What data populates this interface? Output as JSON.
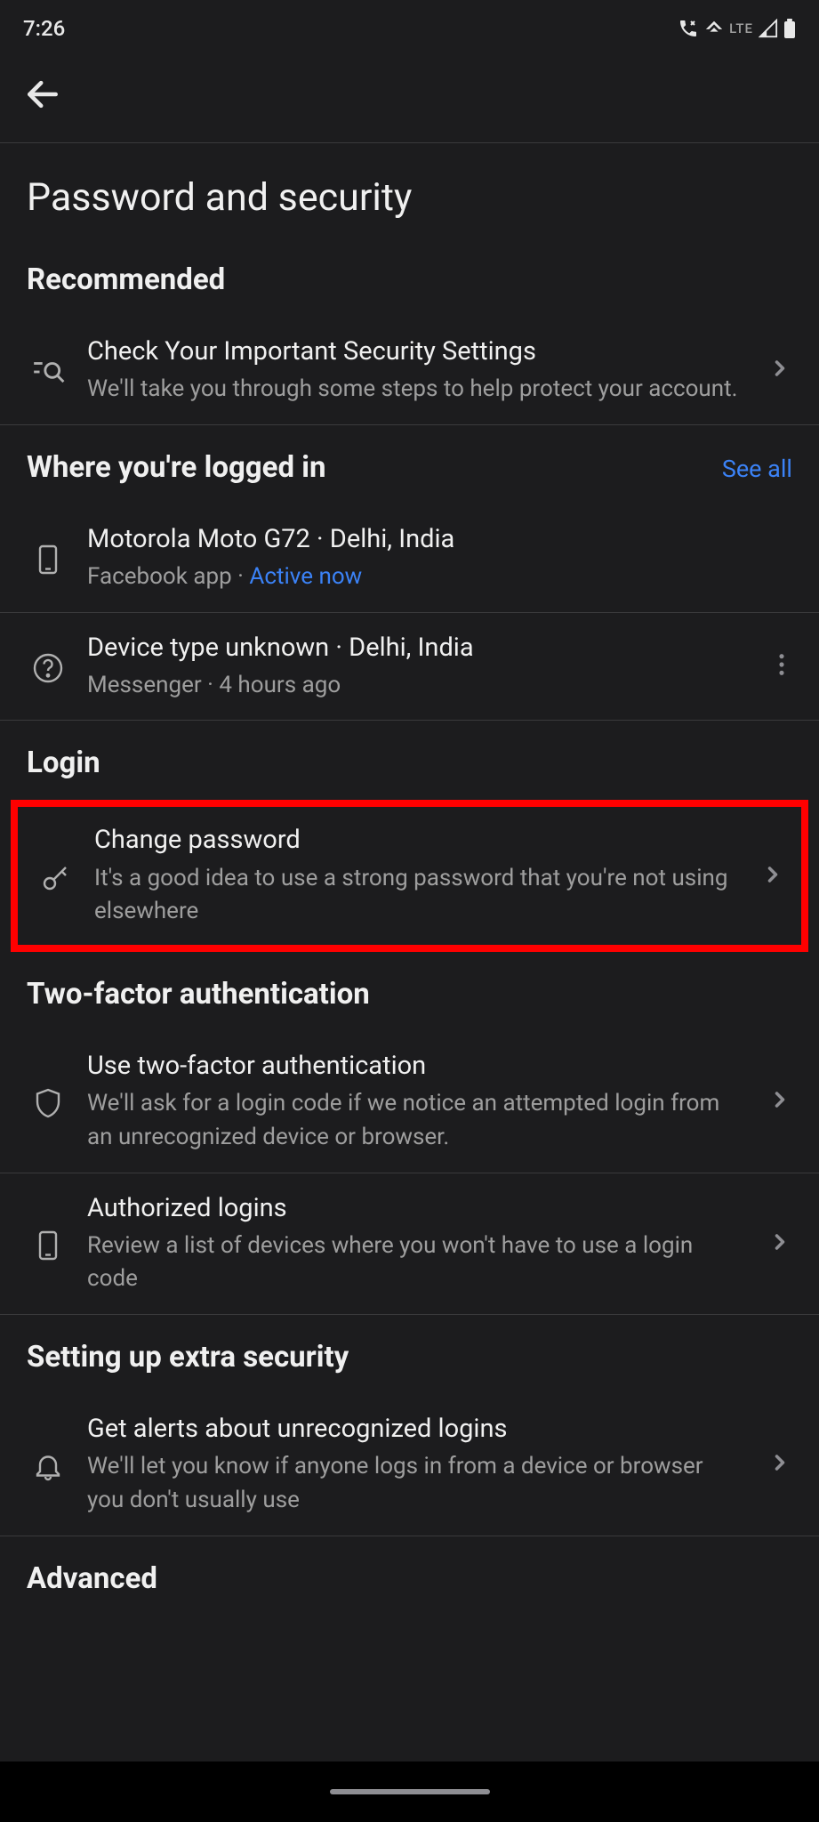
{
  "status": {
    "time": "7:26",
    "lte": "LTE"
  },
  "page": {
    "title": "Password and security"
  },
  "recommended": {
    "heading": "Recommended",
    "item": {
      "title": "Check Your Important Security Settings",
      "subtitle": "We'll take you through some steps to help protect your account."
    }
  },
  "loggedIn": {
    "heading": "Where you're logged in",
    "seeAll": "See all",
    "devices": [
      {
        "title": "Motorola Moto G72 · Delhi, India",
        "app": "Facebook app · ",
        "status": "Active now"
      },
      {
        "title": "Device type unknown · Delhi, India",
        "app": "Messenger · 4 hours ago"
      }
    ]
  },
  "login": {
    "heading": "Login",
    "changePassword": {
      "title": "Change password",
      "subtitle": "It's a good idea to use a strong password that you're not using elsewhere"
    }
  },
  "twoFactor": {
    "heading": "Two-factor authentication",
    "use": {
      "title": "Use two-factor authentication",
      "subtitle": "We'll ask for a login code if we notice an attempted login from an unrecognized device or browser."
    },
    "authorized": {
      "title": "Authorized logins",
      "subtitle": "Review a list of devices where you won't have to use a login code"
    }
  },
  "extraSecurity": {
    "heading": "Setting up extra security",
    "alerts": {
      "title": "Get alerts about unrecognized logins",
      "subtitle": "We'll let you know if anyone logs in from a device or browser you don't usually use"
    }
  },
  "advanced": {
    "heading": "Advanced"
  }
}
